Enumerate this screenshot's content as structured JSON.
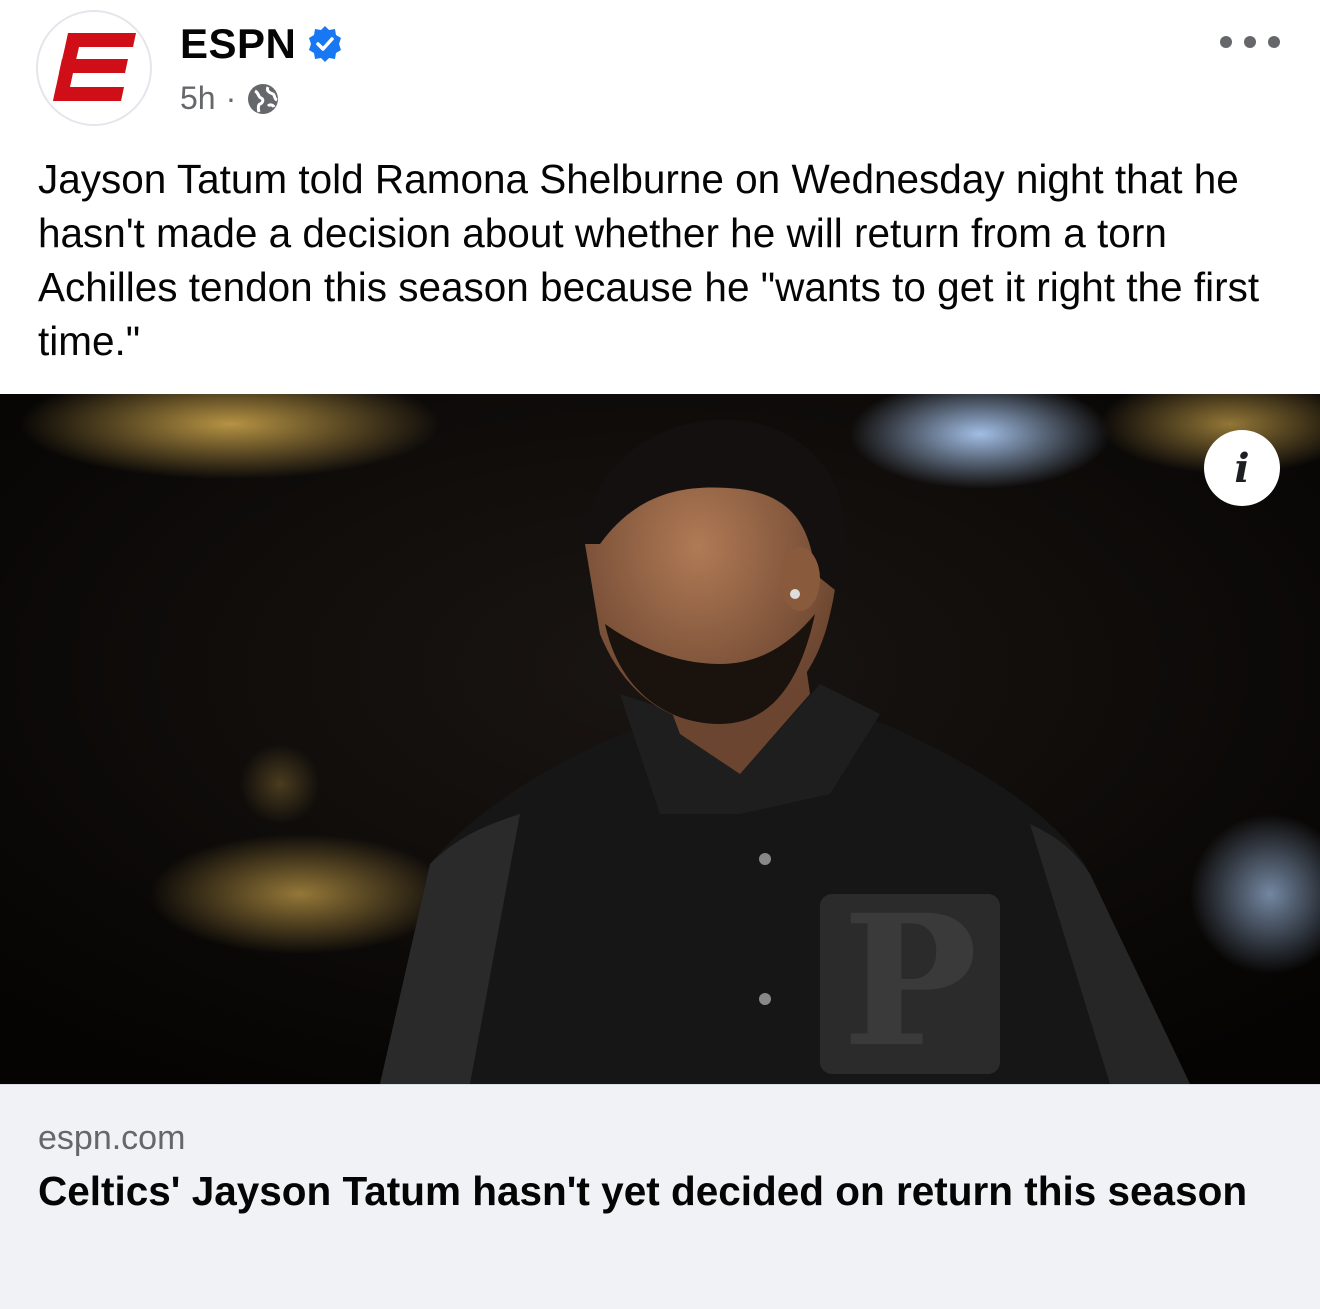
{
  "header": {
    "page_name": "ESPN",
    "verified_icon": "verified-badge-icon",
    "timestamp": "5h",
    "separator": "·",
    "audience_icon": "globe-icon",
    "more_icon": "more-options-icon"
  },
  "post": {
    "text": "Jayson Tatum told Ramona Shelburne on Wednesday night that he hasn't made a decision about whether he will return from a torn Achilles tendon this season because he \"wants to get it right the first time.\""
  },
  "media": {
    "info_icon": "info-icon",
    "info_label": "i"
  },
  "link": {
    "domain": "espn.com",
    "title": "Celtics' Jayson Tatum hasn't yet decided on return this season"
  },
  "colors": {
    "brand_red": "#d00e18",
    "verified_blue": "#1877f2",
    "secondary_text": "#65676b",
    "preview_bg": "#f0f2f5"
  }
}
